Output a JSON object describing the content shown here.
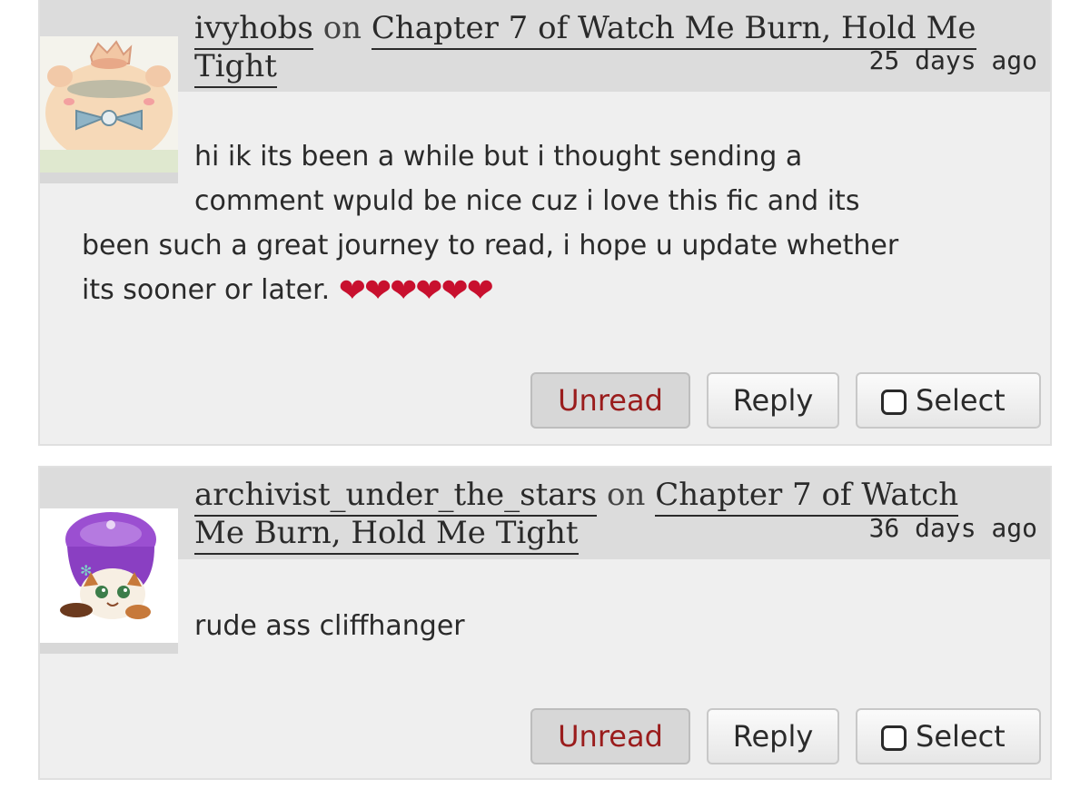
{
  "comments": [
    {
      "author": "ivyhobs",
      "on_text": "on",
      "work_link": "Chapter 7 of Watch Me Burn, Hold Me Tight",
      "time": "25 days ago",
      "body_line1": "hi ik its been a while but i thought sending a",
      "body_line2": "comment wpuld be nice cuz i love this fic and its",
      "body_line3": "been such a great journey to read, i hope u update whether",
      "body_line4": "its sooner or later.",
      "hearts": "❤❤❤❤❤❤",
      "avatar": "pig-with-crown-avatar",
      "buttons": {
        "unread": "Unread",
        "reply": "Reply",
        "select": "Select"
      }
    },
    {
      "author": "archivist_under_the_stars",
      "on_text": "on",
      "work_link": "Chapter 7 of Watch Me Burn, Hold Me Tight",
      "time": "36 days ago",
      "body": "rude ass cliffhanger",
      "avatar": "cat-in-purple-hat-avatar",
      "buttons": {
        "unread": "Unread",
        "reply": "Reply",
        "select": "Select"
      }
    }
  ],
  "colors": {
    "card_background": "#efefef",
    "heading_background": "#dcdcdc",
    "unread_text": "#9a1c1c",
    "heart": "#c8102e"
  }
}
